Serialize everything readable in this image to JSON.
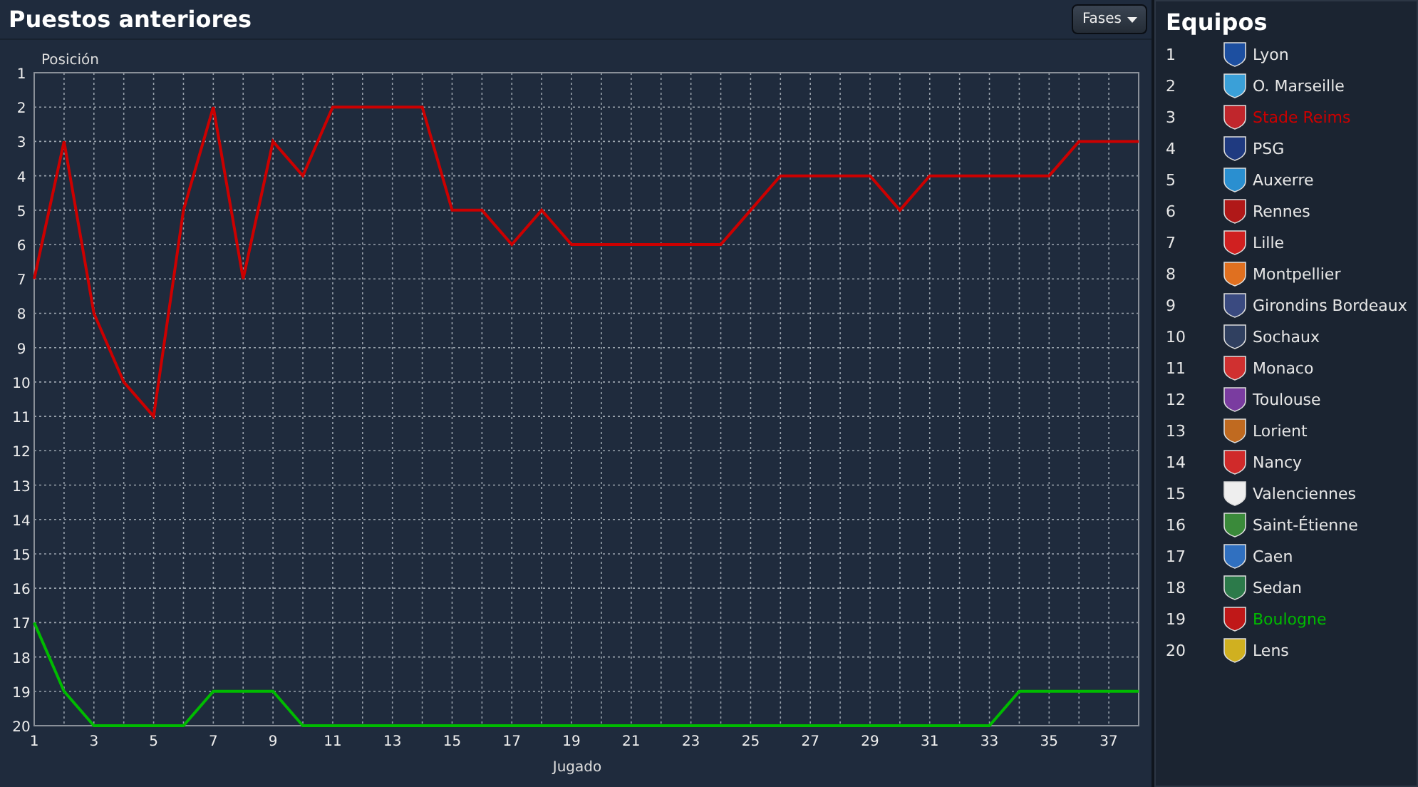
{
  "header": {
    "title": "Puestos anteriores",
    "button": {
      "label": "Fases"
    }
  },
  "chart_data": {
    "type": "line",
    "xlabel": "Jugado",
    "ylabel": "Posición",
    "x": [
      1,
      2,
      3,
      4,
      5,
      6,
      7,
      8,
      9,
      10,
      11,
      12,
      13,
      14,
      15,
      16,
      17,
      18,
      19,
      20,
      21,
      22,
      23,
      24,
      25,
      26,
      27,
      28,
      29,
      30,
      31,
      32,
      33,
      34,
      35,
      36,
      37,
      38
    ],
    "grid": true,
    "xlim": [
      1,
      38
    ],
    "ylim": [
      20,
      1
    ],
    "xticks": [
      1,
      3,
      5,
      7,
      9,
      11,
      13,
      15,
      17,
      19,
      21,
      23,
      25,
      27,
      29,
      31,
      33,
      35,
      37
    ],
    "yticks": [
      1,
      2,
      3,
      4,
      5,
      6,
      7,
      8,
      9,
      10,
      11,
      12,
      13,
      14,
      15,
      16,
      17,
      18,
      19,
      20
    ],
    "series": [
      {
        "color": "#cc0000",
        "values": [
          7,
          3,
          8,
          10,
          11,
          5,
          2,
          7,
          3,
          4,
          2,
          2,
          2,
          2,
          5,
          5,
          6,
          5,
          6,
          6,
          6,
          6,
          6,
          6,
          5,
          4,
          4,
          4,
          4,
          5,
          4,
          4,
          4,
          4,
          4,
          3,
          3,
          3
        ]
      },
      {
        "color": "#00bb00",
        "values": [
          17,
          19,
          20,
          20,
          20,
          20,
          19,
          19,
          19,
          20,
          20,
          20,
          20,
          20,
          20,
          20,
          20,
          20,
          20,
          20,
          20,
          20,
          20,
          20,
          20,
          20,
          20,
          20,
          20,
          20,
          20,
          20,
          20,
          19,
          19,
          19,
          19,
          19
        ]
      }
    ]
  },
  "legend": {
    "title": "Equipos",
    "teams": [
      {
        "rank": "1",
        "name": "Lyon",
        "color": "#e6e6e6"
      },
      {
        "rank": "2",
        "name": "O. Marseille",
        "color": "#e6e6e6"
      },
      {
        "rank": "3",
        "name": "Stade Reims",
        "color": "#cc0000"
      },
      {
        "rank": "4",
        "name": "PSG",
        "color": "#e6e6e6"
      },
      {
        "rank": "5",
        "name": "Auxerre",
        "color": "#e6e6e6"
      },
      {
        "rank": "6",
        "name": "Rennes",
        "color": "#e6e6e6"
      },
      {
        "rank": "7",
        "name": "Lille",
        "color": "#e6e6e6"
      },
      {
        "rank": "8",
        "name": "Montpellier",
        "color": "#e6e6e6"
      },
      {
        "rank": "9",
        "name": "Girondins Bordeaux",
        "color": "#e6e6e6"
      },
      {
        "rank": "10",
        "name": "Sochaux",
        "color": "#e6e6e6"
      },
      {
        "rank": "11",
        "name": "Monaco",
        "color": "#e6e6e6"
      },
      {
        "rank": "12",
        "name": "Toulouse",
        "color": "#e6e6e6"
      },
      {
        "rank": "13",
        "name": "Lorient",
        "color": "#e6e6e6"
      },
      {
        "rank": "14",
        "name": "Nancy",
        "color": "#e6e6e6"
      },
      {
        "rank": "15",
        "name": "Valenciennes",
        "color": "#e6e6e6"
      },
      {
        "rank": "16",
        "name": "Saint-Étienne",
        "color": "#e6e6e6"
      },
      {
        "rank": "17",
        "name": "Caen",
        "color": "#e6e6e6"
      },
      {
        "rank": "18",
        "name": "Sedan",
        "color": "#e6e6e6"
      },
      {
        "rank": "19",
        "name": "Boulogne",
        "color": "#00bb00"
      },
      {
        "rank": "20",
        "name": "Lens",
        "color": "#e6e6e6"
      }
    ]
  }
}
